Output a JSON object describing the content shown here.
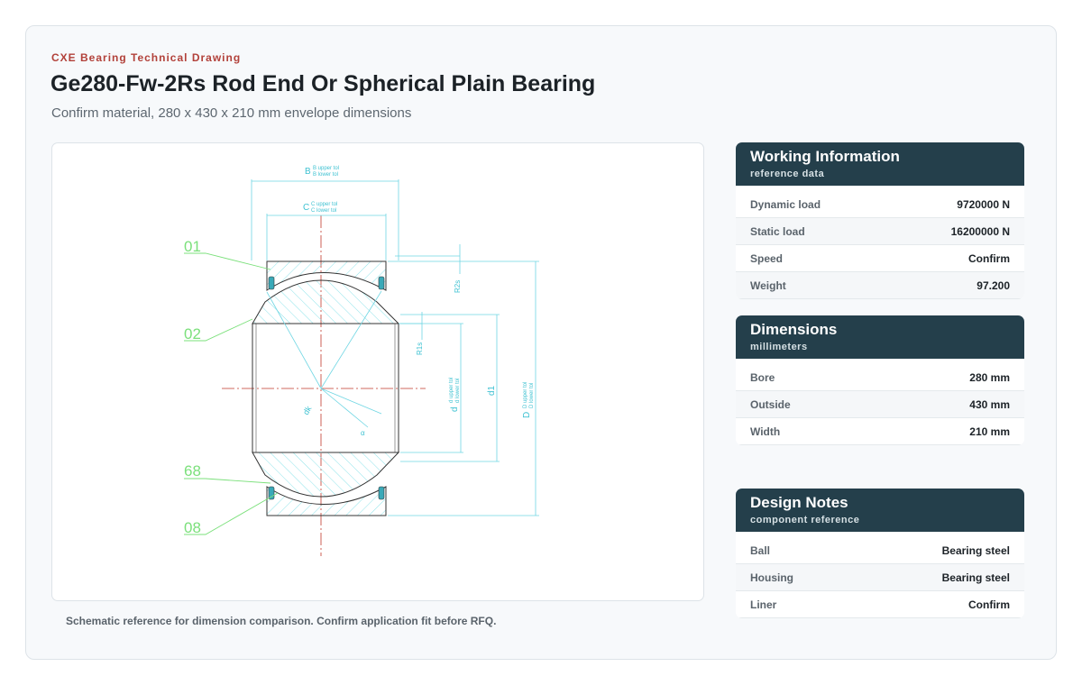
{
  "header": {
    "eyebrow": "CXE Bearing Technical Drawing",
    "title": "Ge280-Fw-2Rs Rod End Or Spherical Plain Bearing",
    "subtitle": "Confirm material, 280 x 430 x 210 mm envelope dimensions"
  },
  "drawing": {
    "labels": {
      "b": "B",
      "b_upper": "B upper tol",
      "b_lower": "B lower tol",
      "c": "C",
      "c_upper": "C upper tol",
      "c_lower": "C lower tol",
      "r1s": "R1s",
      "r2s": "R2s",
      "d": "d",
      "d_upper": "d upper tol",
      "d_lower": "d lower tol",
      "d1": "d1",
      "dd": "D",
      "dd_upper": "D upper tol",
      "dd_lower": "D lower tol",
      "dk": "dk",
      "alpha": "α",
      "part_01": "01",
      "part_02": "02",
      "part_68": "68",
      "part_08": "08"
    },
    "colors": {
      "dimension": "#6fd6e3",
      "callout": "#7be07b",
      "outline": "#333333",
      "centerline": "#c0392b"
    }
  },
  "caption": "Schematic reference for dimension comparison. Confirm application fit before RFQ.",
  "panels": {
    "working": {
      "title": "Working Information",
      "subtitle": "reference data",
      "rows": [
        {
          "label": "Dynamic load",
          "value": "9720000 N"
        },
        {
          "label": "Static load",
          "value": "16200000 N"
        },
        {
          "label": "Speed",
          "value": "Confirm"
        },
        {
          "label": "Weight",
          "value": "97.200"
        }
      ]
    },
    "dimensions": {
      "title": "Dimensions",
      "subtitle": "millimeters",
      "rows": [
        {
          "label": "Bore",
          "value": "280 mm"
        },
        {
          "label": "Outside",
          "value": "430 mm"
        },
        {
          "label": "Width",
          "value": "210 mm"
        }
      ]
    },
    "notes": {
      "title": "Design Notes",
      "subtitle": "component reference",
      "rows": [
        {
          "label": "Ball",
          "value": "Bearing steel"
        },
        {
          "label": "Housing",
          "value": "Bearing steel"
        },
        {
          "label": "Liner",
          "value": "Confirm"
        }
      ]
    }
  }
}
